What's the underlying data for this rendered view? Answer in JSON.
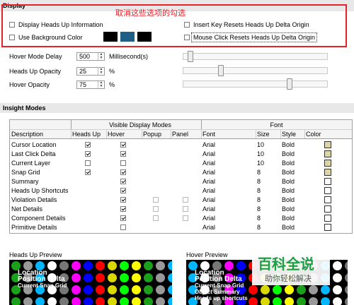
{
  "display": {
    "title": "Display",
    "annotation": "取消这些选项的勾选",
    "display_heads_up": "Display Heads Up Information",
    "insert_key": "Insert Key Resets Heads Up Delta Origin",
    "use_background": "Use Background Color",
    "mouse_click": "Mouse Click Resets Heads Up Delta Origin",
    "background_colors": [
      "#000000",
      "#1f5f86",
      "#000000"
    ]
  },
  "settings": {
    "hover_mode_delay": {
      "label": "Hover Mode Delay",
      "value": "500",
      "unit": "Millisecond(s)",
      "level": 0.03
    },
    "heads_up_opacity": {
      "label": "Heads Up Opacity",
      "value": "25",
      "unit": "%",
      "level": 0.25
    },
    "hover_opacity": {
      "label": "Hover Opacity",
      "value": "75",
      "unit": "%",
      "level": 0.75
    }
  },
  "insight": {
    "title": "Insight Modes",
    "group_visible": "Visible Display Modes",
    "group_font": "Font",
    "columns": [
      "Description",
      "Heads Up",
      "Hover",
      "Popup",
      "Panel",
      "Font",
      "Size",
      "Style",
      "Color"
    ],
    "rows": [
      {
        "desc": "Cursor Location",
        "headsup": "on",
        "hover": "on",
        "popup": "none",
        "panel": "none",
        "font": "Arial",
        "size": "10",
        "style": "Bold",
        "color": "#dcd5a6"
      },
      {
        "desc": "Last Click Delta",
        "headsup": "on",
        "hover": "on",
        "popup": "none",
        "panel": "none",
        "font": "Arial",
        "size": "10",
        "style": "Bold",
        "color": "#dcd5a6"
      },
      {
        "desc": "Current Layer",
        "headsup": "off",
        "hover": "off",
        "popup": "none",
        "panel": "none",
        "font": "Arial",
        "size": "10",
        "style": "Bold",
        "color": "#dcd5a6"
      },
      {
        "desc": "Snap Grid",
        "headsup": "on",
        "hover": "on",
        "popup": "none",
        "panel": "none",
        "font": "Arial",
        "size": "8",
        "style": "Bold",
        "color": "#dcd5a6"
      },
      {
        "desc": "Summary",
        "headsup": "none",
        "hover": "on",
        "popup": "none",
        "panel": "none",
        "font": "Arial",
        "size": "8",
        "style": "Bold",
        "color": "#ffffff"
      },
      {
        "desc": "Heads Up Shortcuts",
        "headsup": "none",
        "hover": "on",
        "popup": "none",
        "panel": "none",
        "font": "Arial",
        "size": "8",
        "style": "Bold",
        "color": "#ffffff"
      },
      {
        "desc": "Violation Details",
        "headsup": "none",
        "hover": "on",
        "popup": "gray",
        "panel": "gray",
        "font": "Arial",
        "size": "8",
        "style": "Bold",
        "color": "#ffffff"
      },
      {
        "desc": "Net Details",
        "headsup": "none",
        "hover": "on",
        "popup": "gray",
        "panel": "gray",
        "font": "Arial",
        "size": "8",
        "style": "Bold",
        "color": "#ffffff"
      },
      {
        "desc": "Component Details",
        "headsup": "none",
        "hover": "on",
        "popup": "gray",
        "panel": "gray",
        "font": "Arial",
        "size": "8",
        "style": "Bold",
        "color": "#ffffff"
      },
      {
        "desc": "Primitive Details",
        "headsup": "none",
        "hover": "off",
        "popup": "none",
        "panel": "none",
        "font": "Arial",
        "size": "8",
        "style": "Bold",
        "color": "#ffffff"
      }
    ]
  },
  "previews": {
    "heads_up": {
      "title": "Heads Up Preview",
      "lines": [
        "Location",
        "Position Delta",
        "Current Snap Grid"
      ]
    },
    "hover": {
      "title": "Hover Preview",
      "lines": [
        "Location",
        "Position Delta",
        "Current Snap Grid",
        "Object Summary",
        "Heads up shortcuts"
      ]
    },
    "dot_colors": [
      "#1aa01a",
      "#d9d900",
      "#ff00ff",
      "#00b7ff",
      "#ffff00",
      "#ff0000",
      "#777777",
      "#999999",
      "#00ff00",
      "#0000ff",
      "#ffffff"
    ]
  },
  "watermark": {
    "main": "百科全说",
    "sub": "助你轻松解决"
  }
}
